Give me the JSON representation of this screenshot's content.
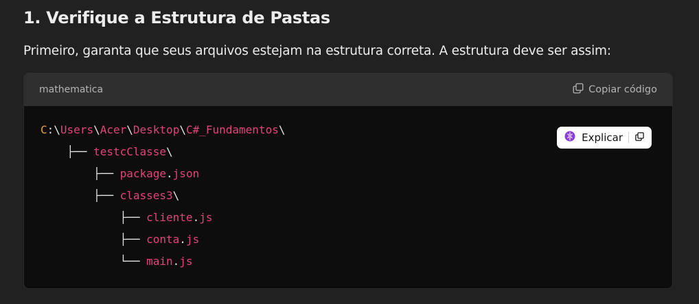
{
  "section": {
    "heading": "1. Verifique a Estrutura de Pastas",
    "paragraph": "Primeiro, garanta que seus arquivos estejam na estrutura correta. A estrutura deve ser assim:"
  },
  "code_block": {
    "language": "mathematica",
    "copy_label": "Copiar código",
    "explain_label": "Explicar",
    "lines": [
      [
        {
          "t": "C",
          "c": "drive"
        },
        {
          "t": ":\\",
          "c": "punct"
        },
        {
          "t": "Users",
          "c": "ident"
        },
        {
          "t": "\\",
          "c": "punct"
        },
        {
          "t": "Acer",
          "c": "ident"
        },
        {
          "t": "\\",
          "c": "punct"
        },
        {
          "t": "Desktop",
          "c": "ident"
        },
        {
          "t": "\\",
          "c": "punct"
        },
        {
          "t": "C#_Fundamentos",
          "c": "ident"
        },
        {
          "t": "\\",
          "c": "punct"
        }
      ],
      [
        {
          "t": "    ├── ",
          "c": "tree"
        },
        {
          "t": "testcClasse",
          "c": "ident"
        },
        {
          "t": "\\",
          "c": "punct"
        }
      ],
      [
        {
          "t": "        ├── ",
          "c": "tree"
        },
        {
          "t": "package",
          "c": "ident"
        },
        {
          "t": ".",
          "c": "punct"
        },
        {
          "t": "json",
          "c": "ident"
        }
      ],
      [
        {
          "t": "        ├── ",
          "c": "tree"
        },
        {
          "t": "classes3",
          "c": "ident"
        },
        {
          "t": "\\",
          "c": "punct"
        }
      ],
      [
        {
          "t": "            ├── ",
          "c": "tree"
        },
        {
          "t": "cliente",
          "c": "ident"
        },
        {
          "t": ".",
          "c": "punct"
        },
        {
          "t": "js",
          "c": "ident"
        }
      ],
      [
        {
          "t": "            ├── ",
          "c": "tree"
        },
        {
          "t": "conta",
          "c": "ident"
        },
        {
          "t": ".",
          "c": "punct"
        },
        {
          "t": "js",
          "c": "ident"
        }
      ],
      [
        {
          "t": "            └── ",
          "c": "tree"
        },
        {
          "t": "main",
          "c": "ident"
        },
        {
          "t": ".",
          "c": "punct"
        },
        {
          "t": "js",
          "c": "ident"
        }
      ]
    ]
  },
  "icons": {
    "copy": "copy-icon",
    "brain": "brain-icon",
    "pill_copy": "copy-icon"
  },
  "colors": {
    "background": "#212121",
    "code_bg": "#0d0d0d",
    "header_bg": "#2f2f2f",
    "identifier": "#e0457b",
    "drive_letter": "#e8a33a",
    "brain_icon": "#8b3fd9"
  }
}
